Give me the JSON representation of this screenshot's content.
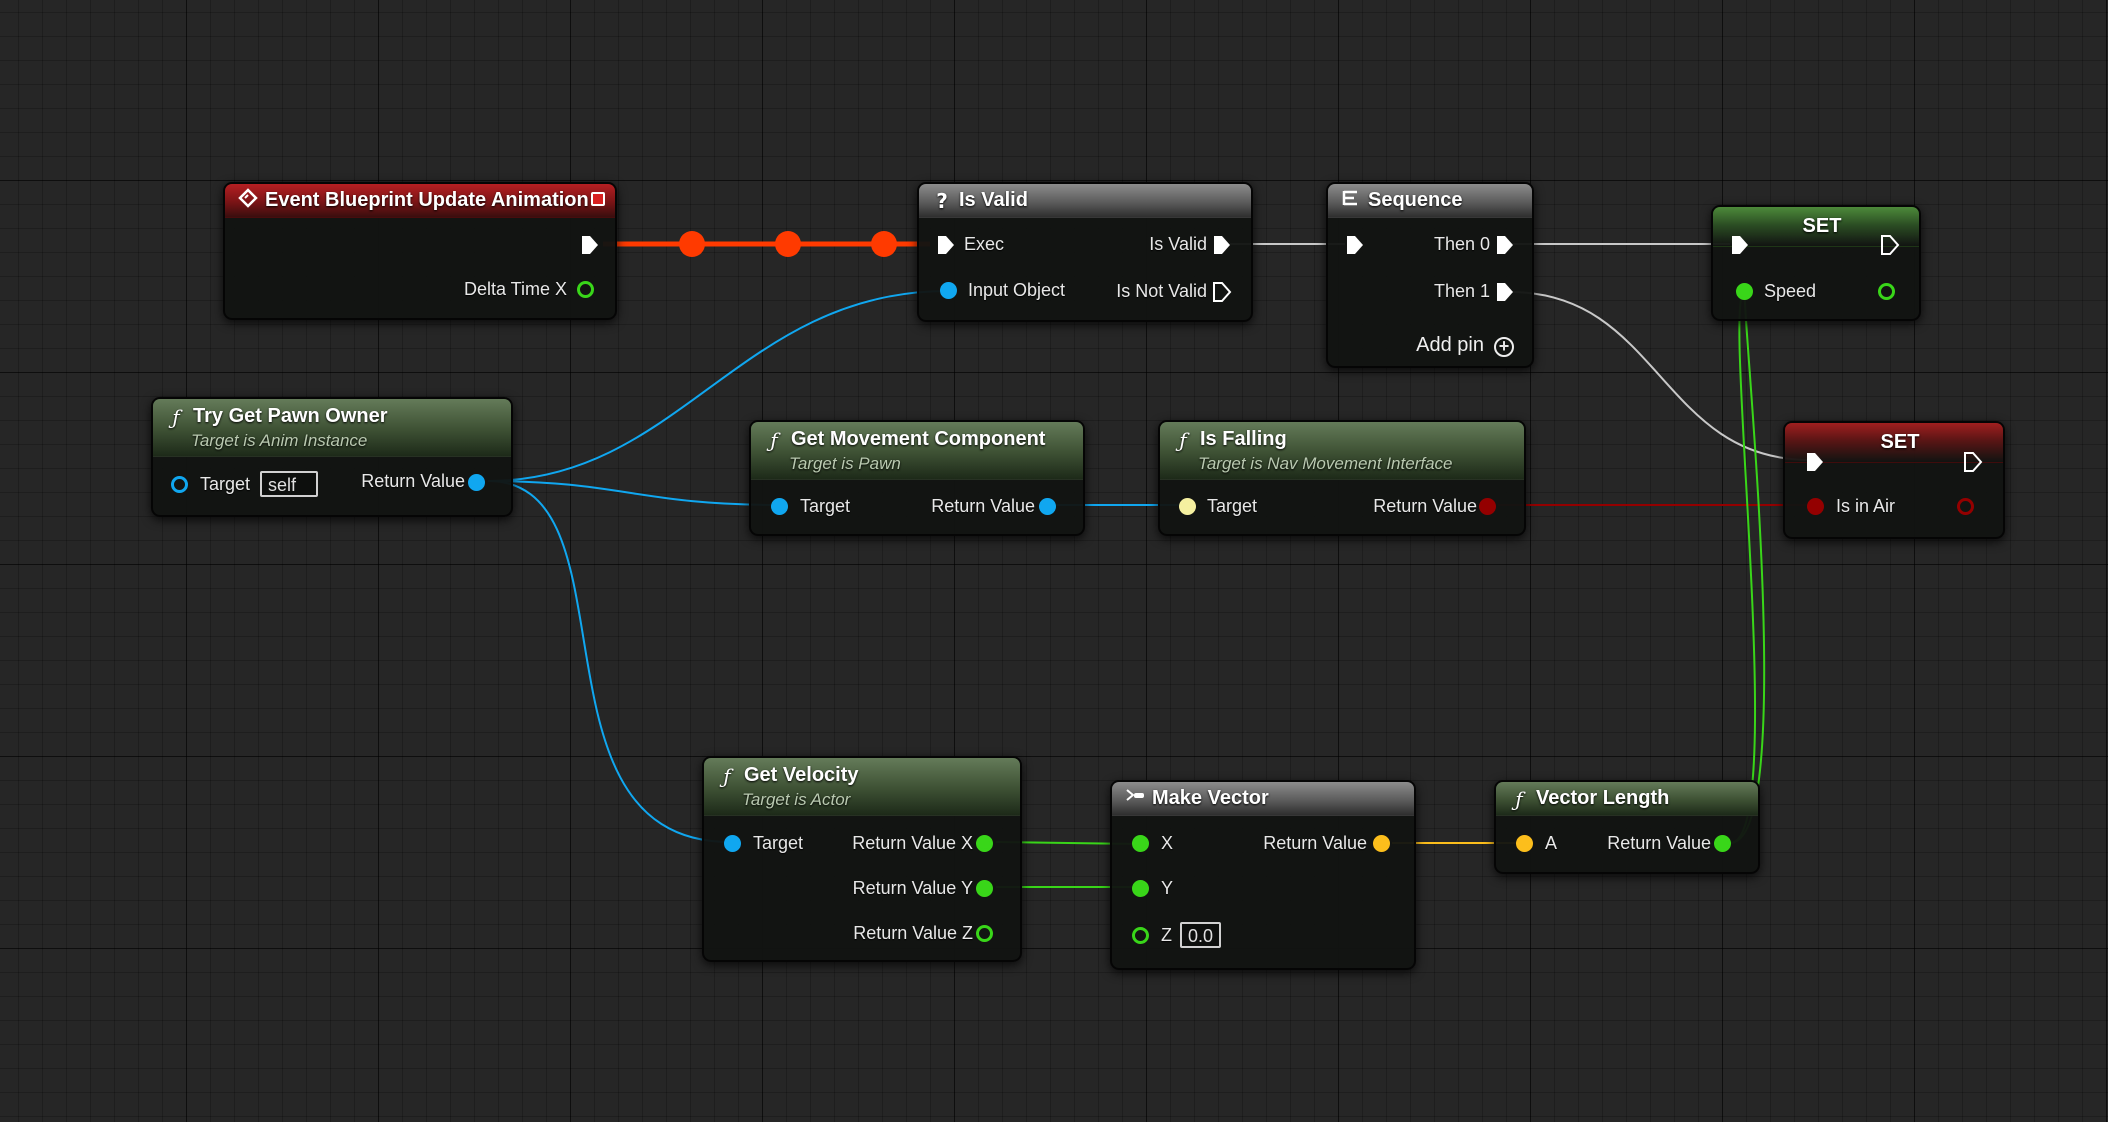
{
  "graph": {
    "nodes": {
      "event_update": {
        "title": "Event Blueprint Update Animation",
        "icon": "event-diamond-icon",
        "pins": {
          "delta_time": "Delta Time X"
        }
      },
      "is_valid": {
        "title": "Is Valid",
        "icon": "question-mark-icon",
        "pins": {
          "exec": "Exec",
          "input_object": "Input Object",
          "is_valid": "Is Valid",
          "is_not_valid": "Is Not Valid"
        }
      },
      "sequence": {
        "title": "Sequence",
        "icon": "sequence-icon",
        "pins": {
          "then0": "Then 0",
          "then1": "Then 1"
        },
        "add_pin": "Add pin"
      },
      "set_speed": {
        "title": "SET",
        "pins": {
          "speed": "Speed"
        }
      },
      "set_in_air": {
        "title": "SET",
        "pins": {
          "is_in_air": "Is in Air"
        }
      },
      "try_get_pawn": {
        "title": "Try Get Pawn Owner",
        "subtitle": "Target is Anim Instance",
        "pins": {
          "target": "Target",
          "target_default": "self",
          "return_value": "Return Value"
        }
      },
      "get_movement": {
        "title": "Get Movement Component",
        "subtitle": "Target is Pawn",
        "pins": {
          "target": "Target",
          "return_value": "Return Value"
        }
      },
      "is_falling": {
        "title": "Is Falling",
        "subtitle": "Target is Nav Movement Interface",
        "pins": {
          "target": "Target",
          "return_value": "Return Value"
        }
      },
      "get_velocity": {
        "title": "Get Velocity",
        "subtitle": "Target is Actor",
        "pins": {
          "target": "Target",
          "rx": "Return Value X",
          "ry": "Return Value Y",
          "rz": "Return Value Z"
        }
      },
      "make_vector": {
        "title": "Make Vector",
        "icon": "make-struct-icon",
        "pins": {
          "x": "X",
          "y": "Y",
          "z": "Z",
          "z_default": "0.0",
          "return_value": "Return Value"
        }
      },
      "vector_length": {
        "title": "Vector Length",
        "pins": {
          "a": "A",
          "return_value": "Return Value"
        }
      }
    },
    "colors": {
      "exec_wire": "#c8c8c8",
      "exec_active_wire": "#ff3a00",
      "object_pin": "#10a7f0",
      "bool_pin": "#940000",
      "float_pin": "#39d619",
      "vector_pin": "#fcbe1c",
      "struct_pin": "#f5f0a0"
    },
    "icons": {
      "function": "function-f-icon",
      "event": "event-diamond-icon"
    }
  }
}
